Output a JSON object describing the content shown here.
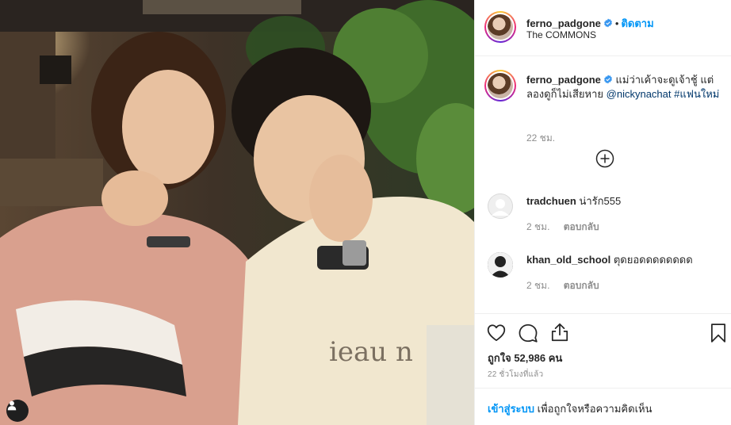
{
  "post": {
    "username": "ferno_padgone",
    "follow_label": "ติดตาม",
    "location": "The COMMONS",
    "caption_text": "แม่ว่าเค้าจะดูเจ้าชู้ แต่ลองดูก็ไม่เสียหาย",
    "caption_mention": "@nickynachat",
    "caption_hashtag": "#แฟนใหม่",
    "caption_time": "22 ชม.",
    "likes": "ถูกใจ 52,986 คน",
    "posted_ago": "22 ชั่วโมงที่แล้ว"
  },
  "comments": [
    {
      "username": "tradchuen",
      "text": "น่ารัก555",
      "time": "2 ชม.",
      "reply_label": "ตอบกลับ"
    },
    {
      "username": "khan_old_school",
      "text": "ตุดยอดดดดดดดด",
      "time": "2 ชม.",
      "reply_label": "ตอบกลับ"
    }
  ],
  "login_bar": {
    "link": "เข้าสู่ระบบ",
    "rest": "เพื่อถูกใจหรือความคิดเห็น"
  },
  "colors": {
    "accent_blue": "#0095f6",
    "link_dark_blue": "#00376b",
    "muted_gray": "#8e8e8e",
    "border": "#efefef"
  },
  "icons": [
    "verified-badge-icon",
    "load-more-plus-icon",
    "heart-icon",
    "comment-icon",
    "share-icon",
    "bookmark-icon",
    "user-tag-icon"
  ]
}
